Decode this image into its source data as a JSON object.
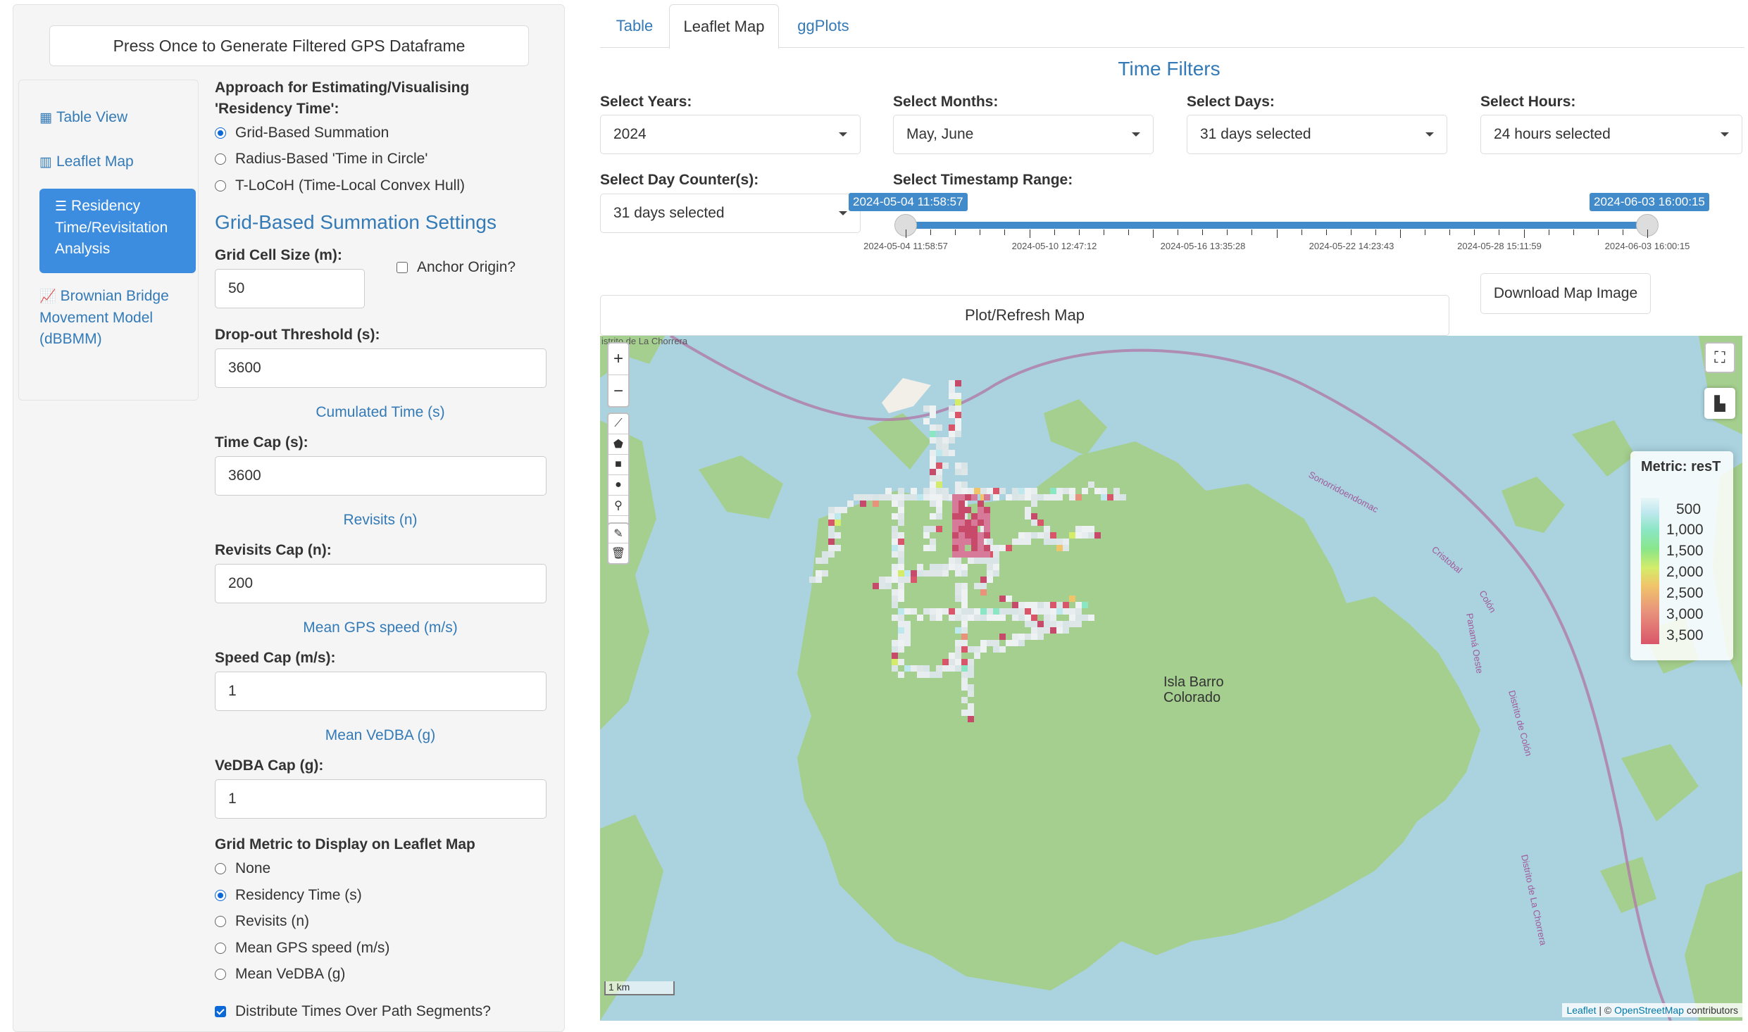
{
  "generate_button": "Press Once to Generate Filtered GPS Dataframe",
  "nav": {
    "items": [
      {
        "label": "Table View",
        "icon": "table-icon"
      },
      {
        "label": "Leaflet Map",
        "icon": "map-icon"
      },
      {
        "label": "Residency Time/Revisitation Analysis",
        "icon": "sliders-icon"
      },
      {
        "label": "Brownian Bridge Movement Model (dBBMM)",
        "icon": "line-chart-icon"
      }
    ]
  },
  "approach": {
    "label_line1": "Approach for Estimating/Visualising",
    "label_line2": "'Residency Time':",
    "options": [
      "Grid-Based Summation",
      "Radius-Based 'Time in Circle'",
      "T-LoCoH (Time-Local Convex Hull)"
    ],
    "selected": "Grid-Based Summation"
  },
  "settings": {
    "heading": "Grid-Based Summation Settings",
    "cell_size_label": "Grid Cell Size (m):",
    "cell_size_value": "50",
    "anchor_label": "Anchor Origin?",
    "dropout_label": "Drop-out Threshold (s):",
    "dropout_value": "3600",
    "cum_time_sub": "Cumulated Time (s)",
    "time_cap_label": "Time Cap (s):",
    "time_cap_value": "3600",
    "revisits_sub": "Revisits (n)",
    "revisits_cap_label": "Revisits Cap (n):",
    "revisits_cap_value": "200",
    "speed_sub": "Mean GPS speed (m/s)",
    "speed_cap_label": "Speed Cap (m/s):",
    "speed_cap_value": "1",
    "vedba_sub": "Mean VeDBA (g)",
    "vedba_cap_label": "VeDBA Cap (g):",
    "vedba_cap_value": "1",
    "metric_label": "Grid Metric to Display on Leaflet Map",
    "metric_options": [
      "None",
      "Residency Time (s)",
      "Revisits (n)",
      "Mean GPS speed (m/s)",
      "Mean VeDBA (g)"
    ],
    "metric_selected": "Residency Time (s)",
    "distribute_label": "Distribute Times Over Path Segments?"
  },
  "tabs": [
    "Table",
    "Leaflet Map",
    "ggPlots"
  ],
  "active_tab": "Leaflet Map",
  "filters": {
    "title": "Time Filters",
    "years_label": "Select Years:",
    "years_value": "2024",
    "months_label": "Select Months:",
    "months_value": "May, June",
    "days_label": "Select Days:",
    "days_value": "31 days selected",
    "hours_label": "Select Hours:",
    "hours_value": "24 hours selected",
    "counter_label": "Select Day Counter(s):",
    "counter_value": "31 days selected",
    "range_label": "Select Timestamp Range:",
    "range_start": "2024-05-04 11:58:57",
    "range_end": "2024-06-03 16:00:15",
    "tick_labels": [
      "2024-05-04 11:58:57",
      "2024-05-10 12:47:12",
      "2024-05-16 13:35:28",
      "2024-05-22 14:23:43",
      "2024-05-28 15:11:59",
      "2024-06-03 16:00:15"
    ]
  },
  "plot_button": "Plot/Refresh Map",
  "download_button": "Download Map Image",
  "map": {
    "top_label": "istrito de La Chorrera",
    "island_label_1": "Isla Barro",
    "island_label_2": "Colorado",
    "road_labels": [
      "Sonorridoendomac",
      "Cristobal",
      "Colón",
      "Panamá Oeste",
      "Distrito de Colón",
      "Distrito de La Chorrera"
    ],
    "scale": "1 km",
    "attribution_leaflet": "Leaflet",
    "attribution_sep": " | © ",
    "attribution_osm": "OpenStreetMap",
    "attribution_tail": " contributors"
  },
  "legend": {
    "title": "Metric: resT",
    "labels": [
      "500",
      "1,000",
      "1,500",
      "2,000",
      "2,500",
      "3,000",
      "3,500"
    ]
  },
  "colors": {
    "accent": "#337ab7",
    "nav_active": "#3c8ddf",
    "slider": "#428bca",
    "water": "#aad3df",
    "land": "#a5cf8e"
  }
}
